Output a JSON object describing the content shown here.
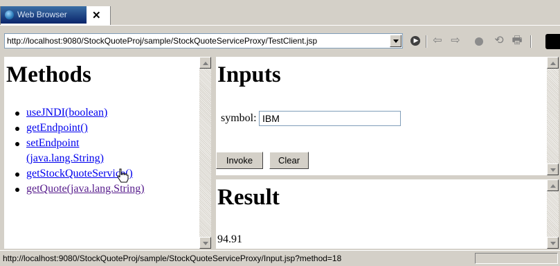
{
  "tab": {
    "title": "Web Browser",
    "close_glyph": "✕"
  },
  "address": {
    "url": "http://localhost:9080/StockQuoteProj/sample/StockQuoteServiceProxy/TestClient.jsp"
  },
  "toolbar": {
    "go_glyph": "▶",
    "back_glyph": "⇦",
    "forward_glyph": "⇨",
    "refresh_glyph": "⟲",
    "print_glyph": "🖶"
  },
  "methods": {
    "heading": "Methods",
    "items": [
      {
        "label": "useJNDI(boolean)"
      },
      {
        "label": "getEndpoint()"
      },
      {
        "label": "setEndpoint (java.lang.String)"
      },
      {
        "label": "getStockQuoteService()"
      },
      {
        "label": "getQuote(java.lang.String)"
      }
    ]
  },
  "inputs": {
    "heading": "Inputs",
    "symbol_label": "symbol:",
    "symbol_value": "IBM",
    "invoke_label": "Invoke",
    "clear_label": "Clear"
  },
  "result": {
    "heading": "Result",
    "value": "94.91"
  },
  "status": {
    "text": "http://localhost:9080/StockQuoteProj/sample/StockQuoteServiceProxy/Input.jsp?method=18"
  },
  "colors": {
    "link": "#0000ee",
    "visited_link": "#551a8b",
    "tab_active": "#0a246a",
    "chrome": "#d4d0c8"
  }
}
